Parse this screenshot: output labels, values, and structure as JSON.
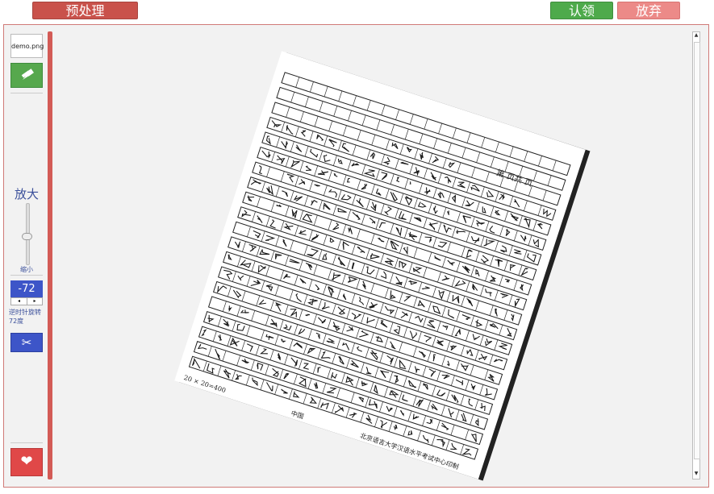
{
  "toolbar": {
    "preprocess_label": "预处理",
    "claim_label": "认领",
    "giveup_label": "放弃"
  },
  "sidebar": {
    "thumbnail_name": "demo.png",
    "zoom_in_label": "放大",
    "zoom_out_label": "缩小",
    "rotation_value": "-72",
    "rotation_text": "逆时针旋转72度",
    "spin_dec": "◂",
    "spin_inc": "▸",
    "crop_icon": "✂",
    "fav_icon": "❤"
  },
  "document": {
    "page_label": "第  页共  页",
    "grid_label": "20 × 20=400",
    "center_label": "中国",
    "footer_label": "北京语言大学汉语水平考试中心印制",
    "rows": 20,
    "cols": 20
  },
  "icons": {
    "apply": "pin-icon",
    "crop": "scissors-icon",
    "favorite": "heart-icon"
  },
  "colors": {
    "preprocess": "#c9524b",
    "claim": "#4eaa4b",
    "giveup": "#ec8a88",
    "accent_blue": "#3d55c8"
  }
}
